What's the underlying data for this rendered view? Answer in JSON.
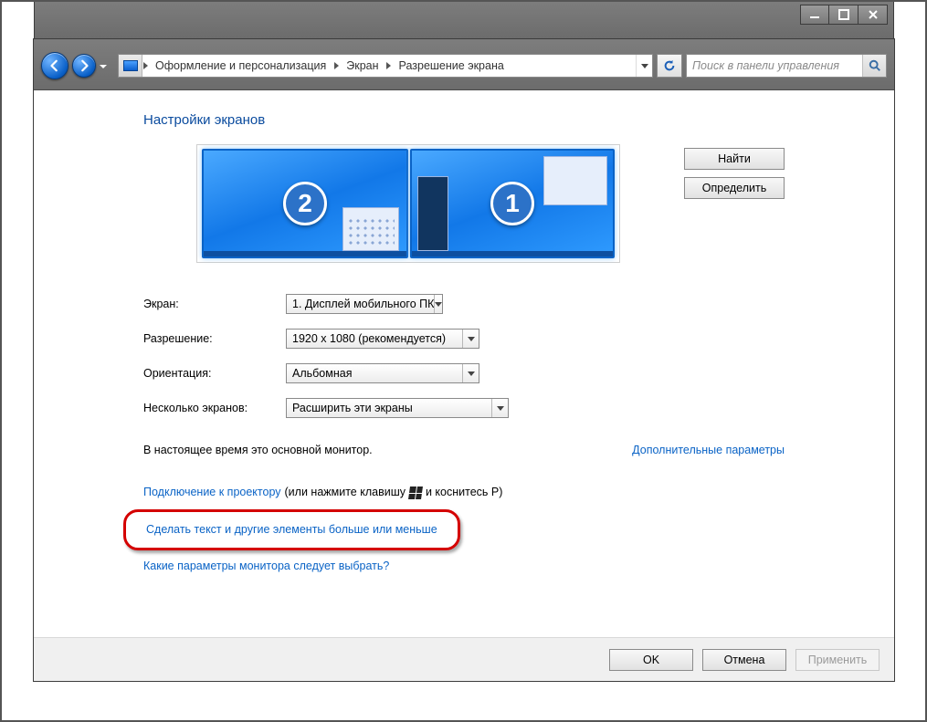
{
  "toolbar": {
    "breadcrumb": [
      "Оформление и персонализация",
      "Экран",
      "Разрешение экрана"
    ],
    "search_placeholder": "Поиск в панели управления"
  },
  "page": {
    "title": "Настройки экранов",
    "buttons": {
      "detect": "Найти",
      "identify": "Определить"
    },
    "monitors": {
      "left_num": "2",
      "right_num": "1"
    },
    "fields": {
      "screen_label": "Экран:",
      "screen_value": "1. Дисплей мобильного ПК",
      "resolution_label": "Разрешение:",
      "resolution_value": "1920 x 1080 (рекомендуется)",
      "orientation_label": "Ориентация:",
      "orientation_value": "Альбомная",
      "multi_label": "Несколько экранов:",
      "multi_value": "Расширить эти экраны"
    },
    "status": "В настоящее время это основной монитор.",
    "advanced_link": "Дополнительные параметры",
    "projector": {
      "link": "Подключение к проектору",
      "tail_a": "(или нажмите клавишу",
      "tail_b": "и коснитесь P)"
    },
    "size_link": "Сделать текст и другие элементы больше или меньше",
    "which_link": "Какие параметры монитора следует выбрать?"
  },
  "footer": {
    "ok": "OK",
    "cancel": "Отмена",
    "apply": "Применить"
  }
}
